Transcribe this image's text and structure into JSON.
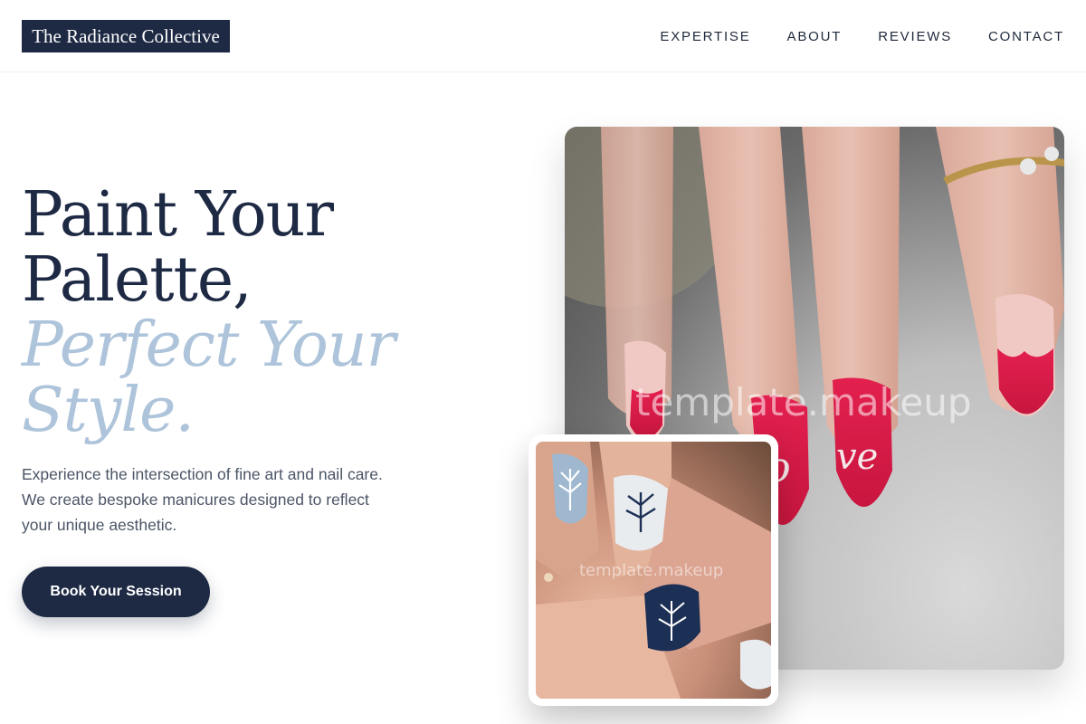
{
  "brand": {
    "name": "The Radiance Collective"
  },
  "nav": {
    "items": [
      {
        "label": "EXPERTISE"
      },
      {
        "label": "ABOUT"
      },
      {
        "label": "REVIEWS"
      },
      {
        "label": "CONTACT"
      }
    ]
  },
  "hero": {
    "headline_line1": "Paint Your",
    "headline_line2": "Palette,",
    "headline_line3": "Perfect Your",
    "headline_line4": "Style.",
    "description_line1": "Experience the intersection of fine art and nail care.",
    "description_line2": "We create bespoke manicures designed to reflect",
    "description_line3": "your unique aesthetic.",
    "cta_label": "Book Your Session"
  },
  "images": {
    "main_watermark": "template.makeup",
    "inset_watermark": "template.makeup"
  },
  "colors": {
    "navy": "#1e2a44",
    "accent_blue": "#aec4da",
    "text_muted": "#4b5566"
  }
}
